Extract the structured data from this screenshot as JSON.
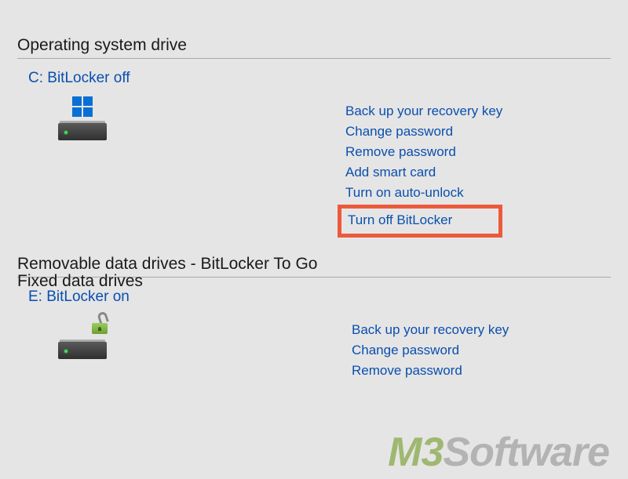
{
  "sections": {
    "os": {
      "title": "Operating system drive",
      "drive_label": "C: BitLocker off",
      "actions": {
        "backup": "Back up your recovery key",
        "change_pw": "Change password",
        "remove_pw": "Remove password",
        "smart_card": "Add smart card",
        "auto_unlock": "Turn on auto-unlock",
        "turn_off": "Turn off BitLocker"
      }
    },
    "fixed": {
      "title": "Fixed data drives"
    },
    "removable": {
      "title": "Removable data drives - BitLocker To Go",
      "drive_label": "E: BitLocker on",
      "actions": {
        "backup": "Back up your recovery key",
        "change_pw": "Change password",
        "remove_pw": "Remove password"
      }
    }
  },
  "watermark": {
    "prefix": "M3",
    "suffix": "Software"
  }
}
